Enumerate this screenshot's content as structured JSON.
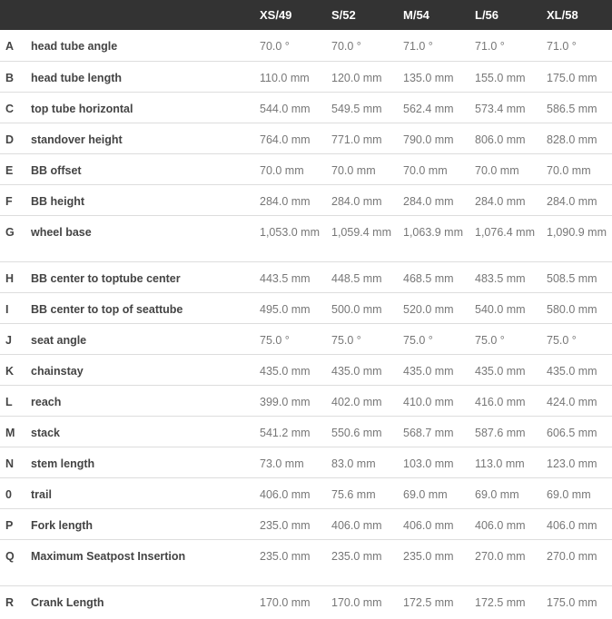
{
  "header": {
    "sizes": [
      "XS/49",
      "S/52",
      "M/54",
      "L/56",
      "XL/58"
    ]
  },
  "rows": [
    {
      "letter": "A",
      "label": "head tube angle",
      "values": [
        "70.0 °",
        "70.0 °",
        "71.0 °",
        "71.0 °",
        "71.0 °"
      ]
    },
    {
      "letter": "B",
      "label": "head tube length",
      "values": [
        "110.0 mm",
        "120.0 mm",
        "135.0 mm",
        "155.0 mm",
        "175.0 mm"
      ]
    },
    {
      "letter": "C",
      "label": "top tube horizontal",
      "values": [
        "544.0 mm",
        "549.5 mm",
        "562.4 mm",
        "573.4 mm",
        "586.5 mm"
      ]
    },
    {
      "letter": "D",
      "label": "standover height",
      "values": [
        "764.0 mm",
        "771.0 mm",
        "790.0 mm",
        "806.0 mm",
        "828.0 mm"
      ]
    },
    {
      "letter": "E",
      "label": "BB offset",
      "values": [
        "70.0 mm",
        "70.0 mm",
        "70.0 mm",
        "70.0 mm",
        "70.0 mm"
      ]
    },
    {
      "letter": "F",
      "label": "BB height",
      "values": [
        "284.0 mm",
        "284.0 mm",
        "284.0 mm",
        "284.0 mm",
        "284.0 mm"
      ]
    },
    {
      "letter": "G",
      "label": "wheel base",
      "values": [
        "1,053.0 mm",
        "1,059.4 mm",
        "1,063.9 mm",
        "1,076.4 mm",
        "1,090.9 mm"
      ]
    },
    {
      "letter": "H",
      "label": "BB center to toptube center",
      "values": [
        "443.5 mm",
        "448.5 mm",
        "468.5 mm",
        "483.5 mm",
        "508.5 mm"
      ]
    },
    {
      "letter": "I",
      "label": "BB center to top of seattube",
      "values": [
        "495.0 mm",
        "500.0 mm",
        "520.0 mm",
        "540.0 mm",
        "580.0 mm"
      ]
    },
    {
      "letter": "J",
      "label": "seat angle",
      "values": [
        "75.0 °",
        "75.0 °",
        "75.0 °",
        "75.0 °",
        "75.0 °"
      ]
    },
    {
      "letter": "K",
      "label": "chainstay",
      "values": [
        "435.0 mm",
        "435.0 mm",
        "435.0 mm",
        "435.0 mm",
        "435.0 mm"
      ]
    },
    {
      "letter": "L",
      "label": "reach",
      "values": [
        "399.0 mm",
        "402.0 mm",
        "410.0 mm",
        "416.0 mm",
        "424.0 mm"
      ]
    },
    {
      "letter": "M",
      "label": "stack",
      "values": [
        "541.2 mm",
        "550.6 mm",
        "568.7 mm",
        "587.6 mm",
        "606.5 mm"
      ]
    },
    {
      "letter": "N",
      "label": "stem length",
      "values": [
        "73.0 mm",
        "83.0 mm",
        "103.0 mm",
        "113.0 mm",
        "123.0 mm"
      ]
    },
    {
      "letter": "0",
      "label": "trail",
      "values": [
        "406.0 mm",
        "75.6 mm",
        "69.0 mm",
        "69.0 mm",
        "69.0 mm"
      ]
    },
    {
      "letter": "P",
      "label": "Fork length",
      "values": [
        "235.0 mm",
        "406.0 mm",
        "406.0 mm",
        "406.0 mm",
        "406.0 mm"
      ]
    },
    {
      "letter": "Q",
      "label": "Maximum Seatpost Insertion",
      "values": [
        "235.0 mm",
        "235.0 mm",
        "235.0 mm",
        "270.0 mm",
        "270.0 mm"
      ]
    },
    {
      "letter": "R",
      "label": "Crank Length",
      "values": [
        "170.0 mm",
        "170.0 mm",
        "172.5 mm",
        "172.5 mm",
        "175.0 mm"
      ]
    }
  ]
}
